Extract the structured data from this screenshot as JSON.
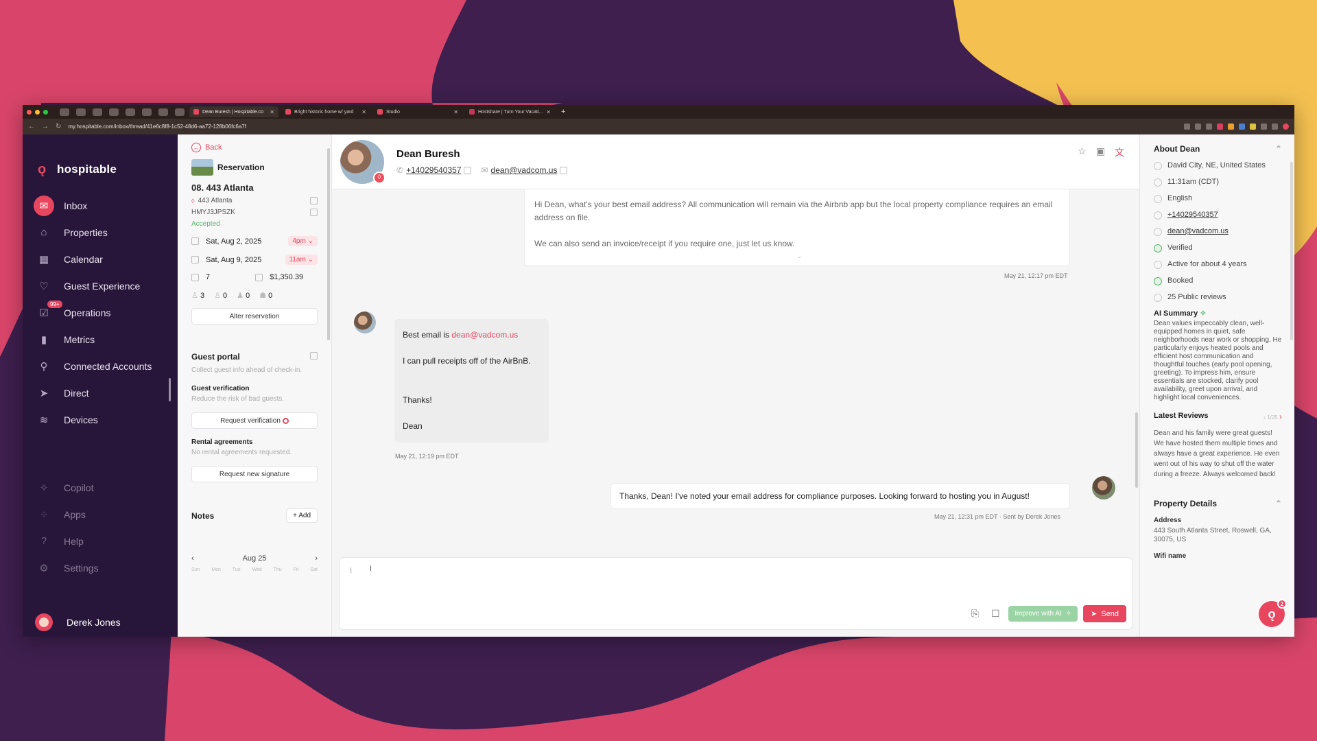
{
  "browser": {
    "tabs": [
      {
        "label": "Dean Buresh | Hospitable.co",
        "fav_color": "#e8455e",
        "active": true
      },
      {
        "label": "Bright historic home w/ yard",
        "fav_color": "#e8455e",
        "active": false
      },
      {
        "label": "Studio",
        "fav_color": "#e8455e",
        "active": false
      },
      {
        "label": "Hostshare | Turn Your Vacati...",
        "fav_color": "#c23a5a",
        "active": false
      }
    ],
    "url": "my.hospitable.com/inbox/thread/41e6c8f8-1c52-48d6-aa72-128b06fc6a7f"
  },
  "app": {
    "name": "hospitable"
  },
  "sidebar": {
    "items": [
      {
        "label": "Inbox",
        "icon": "mail-icon"
      },
      {
        "label": "Properties",
        "icon": "home-icon"
      },
      {
        "label": "Calendar",
        "icon": "calendar-icon"
      },
      {
        "label": "Guest Experience",
        "icon": "heart-icon"
      },
      {
        "label": "Operations",
        "icon": "checklist-icon",
        "badge": "99+"
      },
      {
        "label": "Metrics",
        "icon": "bar-chart-icon"
      },
      {
        "label": "Connected Accounts",
        "icon": "link-icon"
      },
      {
        "label": "Direct",
        "icon": "send-icon"
      },
      {
        "label": "Devices",
        "icon": "wifi-icon"
      }
    ],
    "lower_items": [
      {
        "label": "Copilot",
        "icon": "sparkle-icon"
      },
      {
        "label": "Apps",
        "icon": "apps-icon"
      },
      {
        "label": "Help",
        "icon": "help-icon"
      },
      {
        "label": "Settings",
        "icon": "gear-icon"
      }
    ],
    "user": "Derek Jones"
  },
  "reservation": {
    "back": "Back",
    "type": "Reservation",
    "property": "08. 443 Atlanta",
    "listing": "443 Atlanta",
    "code": "HMYJ3JPSZK",
    "status": "Accepted",
    "checkin_date": "Sat, Aug 2, 2025",
    "checkin_time": "4pm",
    "checkout_date": "Sat, Aug 9, 2025",
    "checkout_time": "11am",
    "nights": "7",
    "total": "$1,350.39",
    "adults": "3",
    "children": "0",
    "infants": "0",
    "pets": "0",
    "alter_label": "Alter reservation",
    "guest_portal_title": "Guest portal",
    "guest_portal_sub": "Collect guest info ahead of check-in.",
    "verification_title": "Guest verification",
    "verification_sub": "Reduce the risk of bad guests.",
    "verification_btn": "Request verification",
    "rental_title": "Rental agreements",
    "rental_sub": "No rental agreements requested.",
    "signature_btn": "Request new signature",
    "notes_title": "Notes",
    "add_label": "+ Add",
    "calendar_month": "Aug 25",
    "weekdays": [
      "Sun",
      "Mon",
      "Tue",
      "Wed",
      "Thu",
      "Fri",
      "Sat"
    ]
  },
  "conversation": {
    "guest_name": "Dean Buresh",
    "phone": "+14029540357",
    "email": "dean@vadcom.us",
    "msg1_line1": "Hi Dean, what's your best email address? All communication will remain via the Airbnb app but the local property compliance requires an email address on file.",
    "msg1_line2": "We can also send an invoice/receipt if you require one, just let us know.",
    "msg1_time": "May 21, 12:17 pm EDT",
    "msg2_prefix": "Best email is ",
    "msg2_email": "dean@vadcom.us",
    "msg2_line2": "I can pull receipts off of the AirBnB.",
    "msg2_line3": "Thanks!",
    "msg2_line4": "Dean",
    "msg2_time": "May 21, 12:19 pm EDT",
    "msg3": "Thanks, Dean! I've noted your email address for compliance purposes. Looking forward to hosting you in August!",
    "msg3_time": "May 21, 12:31 pm EDT · Sent by Derek Jones",
    "composer_cursor": "I",
    "improve_label": "Improve with AI",
    "send_label": "Send"
  },
  "about": {
    "title": "About Dean",
    "location": "David City, NE, United States",
    "local_time": "11:31am (CDT)",
    "language": "English",
    "phone": "+14029540357",
    "email": "dean@vadcom.us",
    "verified": "Verified",
    "active": "Active for about 4 years",
    "booked": "Booked",
    "reviews_count": "25 Public reviews",
    "ai_summary_title": "AI Summary",
    "ai_summary": "Dean values impeccably clean, well-equipped homes in quiet, safe neighborhoods near work or shopping. He particularly enjoys heated pools and efficient host communication and thoughtful touches (early pool opening, greeting). To impress him, ensure essentials are stocked, clarify pool availability, greet upon arrival, and highlight local conveniences.",
    "latest_reviews_title": "Latest Reviews",
    "review_page": "1/25",
    "review_text": "Dean and his family were great guests! We have hosted them multiple times and always have a great experience. He even went out of his way to shut off the water during a freeze. Always welcomed back!",
    "property_details_title": "Property Details",
    "address_label": "Address",
    "address": "443 South Atlanta Street, Roswell, GA, 30075, US",
    "wifi_label": "Wifi name",
    "help_count": "2"
  },
  "colors": {
    "accent": "#e8455e",
    "sidebar_bg": "#28163a",
    "success": "#58b26a"
  }
}
